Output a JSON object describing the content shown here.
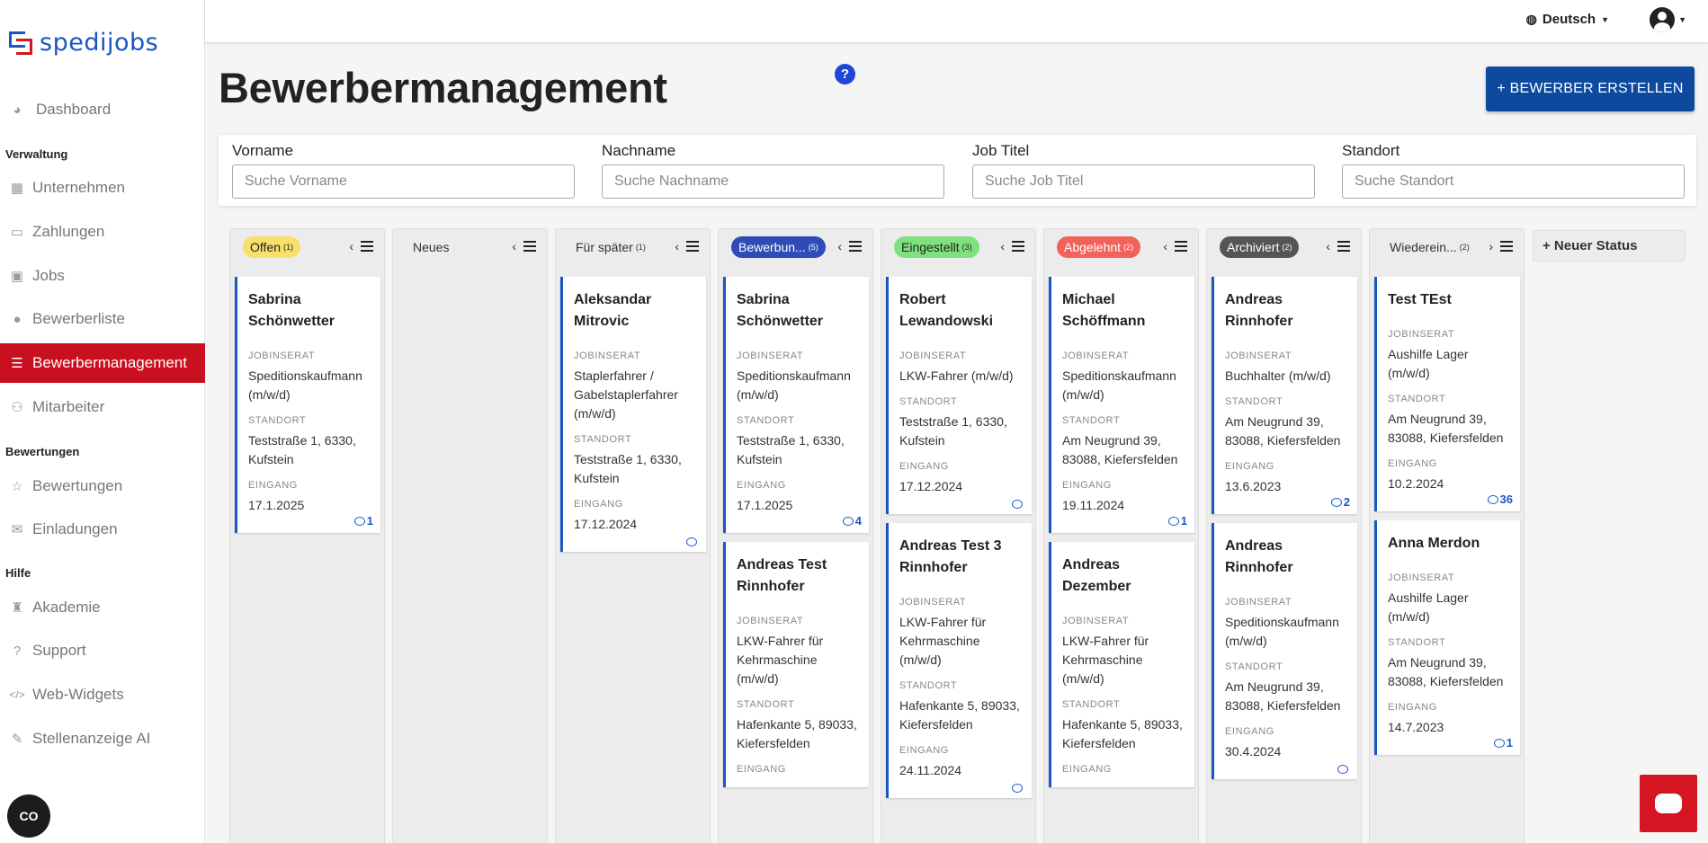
{
  "brand": {
    "name": "spedijobs",
    "colors": {
      "blue": "#1a56c4",
      "red": "#d51622"
    }
  },
  "sidebar": {
    "items": [
      {
        "label": "Dashboard",
        "icon": "dashboard-icon"
      },
      {
        "label": "Unternehmen",
        "icon": "building-icon"
      },
      {
        "label": "Zahlungen",
        "icon": "credit-card-icon"
      },
      {
        "label": "Jobs",
        "icon": "briefcase-icon"
      },
      {
        "label": "Bewerberliste",
        "icon": "user-icon"
      },
      {
        "label": "Bewerbermanagement",
        "icon": "list-icon"
      },
      {
        "label": "Mitarbeiter",
        "icon": "users-icon"
      },
      {
        "label": "Bewertungen",
        "icon": "star-icon"
      },
      {
        "label": "Einladungen",
        "icon": "mail-icon"
      },
      {
        "label": "Akademie",
        "icon": "academy-icon"
      },
      {
        "label": "Support",
        "icon": "question-icon"
      },
      {
        "label": "Web-Widgets",
        "icon": "code-icon"
      },
      {
        "label": "Stellenanzeige AI",
        "icon": "magic-wand-icon"
      }
    ],
    "sections": [
      "Verwaltung",
      "Bewertungen",
      "Hilfe"
    ]
  },
  "topbar": {
    "language": "Deutsch"
  },
  "header": {
    "title": "Bewerbermanagement",
    "help": "?",
    "create_button": "+ BEWERBER ERSTELLEN"
  },
  "filters": [
    {
      "label": "Vorname",
      "placeholder": "Suche Vorname"
    },
    {
      "label": "Nachname",
      "placeholder": "Suche Nachname"
    },
    {
      "label": "Job Titel",
      "placeholder": "Suche Job Titel"
    },
    {
      "label": "Standort",
      "placeholder": "Suche Standort"
    }
  ],
  "card_labels": {
    "jobinserat": "JOBINSERAT",
    "standort": "STANDORT",
    "eingang": "EINGANG"
  },
  "columns": [
    {
      "title": "Offen",
      "count": "(1)",
      "color": "#f7e16b",
      "text_color": "#222",
      "cards": [
        {
          "name": "Sabrina Schönwetter",
          "job": "Speditionskaufmann (m/w/d)",
          "standort": "Teststraße 1, 6330, Kufstein",
          "eingang": "17.1.2025",
          "comments": "1"
        }
      ]
    },
    {
      "title": "Neues",
      "count": "",
      "color": "",
      "text_color": "#333",
      "cards": []
    },
    {
      "title": "Für später",
      "count": "(1)",
      "color": "",
      "text_color": "#333",
      "cards": [
        {
          "name": "Aleksandar Mitrovic",
          "job": "Staplerfahrer / Gabelstaplerfahrer (m/w/d)",
          "standort": "Teststraße 1, 6330, Kufstein",
          "eingang": "17.12.2024",
          "comments": ""
        }
      ]
    },
    {
      "title": "Bewerbun...",
      "count": "(5)",
      "color": "#2f4bb5",
      "text_color": "#fff",
      "cards": [
        {
          "name": "Sabrina Schönwetter",
          "job": "Speditionskaufmann (m/w/d)",
          "standort": "Teststraße 1, 6330, Kufstein",
          "eingang": "17.1.2025",
          "comments": "4"
        },
        {
          "name": "Andreas Test Rinnhofer",
          "job": "LKW-Fahrer für Kehrmaschine (m/w/d)",
          "standort": "Hafenkante 5, 89033, Kiefersfelden",
          "eingang": "",
          "comments": ""
        }
      ]
    },
    {
      "title": "Eingestellt",
      "count": "(3)",
      "color": "#7fe07f",
      "text_color": "#222",
      "cards": [
        {
          "name": "Robert Lewandowski",
          "job": "LKW-Fahrer (m/w/d)",
          "standort": "Teststraße 1, 6330, Kufstein",
          "eingang": "17.12.2024",
          "comments": ""
        },
        {
          "name": "Andreas Test 3 Rinnhofer",
          "job": "LKW-Fahrer für Kehrmaschine (m/w/d)",
          "standort": "Hafenkante 5, 89033, Kiefersfelden",
          "eingang": "24.11.2024",
          "comments": ""
        }
      ]
    },
    {
      "title": "Abgelehnt",
      "count": "(2)",
      "color": "#f0625a",
      "text_color": "#fff",
      "cards": [
        {
          "name": "Michael Schöffmann",
          "job": "Speditionskaufmann (m/w/d)",
          "standort": "Am Neugrund 39, 83088, Kiefersfelden",
          "eingang": "19.11.2024",
          "comments": "1"
        },
        {
          "name": "Andreas Dezember",
          "job": "LKW-Fahrer für Kehrmaschine (m/w/d)",
          "standort": "Hafenkante 5, 89033, Kiefersfelden",
          "eingang": "",
          "comments": ""
        }
      ]
    },
    {
      "title": "Archiviert",
      "count": "(2)",
      "color": "#555555",
      "text_color": "#fff",
      "cards": [
        {
          "name": "Andreas Rinnhofer",
          "job": "Buchhalter (m/w/d)",
          "standort": "Am Neugrund 39, 83088, Kiefersfelden",
          "eingang": "13.6.2023",
          "comments": "2"
        },
        {
          "name": "Andreas Rinnhofer",
          "job": "Speditionskaufmann (m/w/d)",
          "standort": "Am Neugrund 39, 83088, Kiefersfelden",
          "eingang": "30.4.2024",
          "comments": ""
        }
      ]
    },
    {
      "title": "Wiederein...",
      "count": "(2)",
      "color": "",
      "text_color": "#333",
      "cards": [
        {
          "name": "Test TEst",
          "job": "Aushilfe Lager (m/w/d)",
          "standort": "Am Neugrund 39, 83088, Kiefersfelden",
          "eingang": "10.2.2024",
          "comments": "36"
        },
        {
          "name": "Anna Merdon",
          "job": "Aushilfe Lager (m/w/d)",
          "standort": "Am Neugrund 39, 83088, Kiefersfelden",
          "eingang": "14.7.2023",
          "comments": "1"
        }
      ]
    }
  ],
  "new_status": "+ Neuer Status",
  "cookie": "CO"
}
